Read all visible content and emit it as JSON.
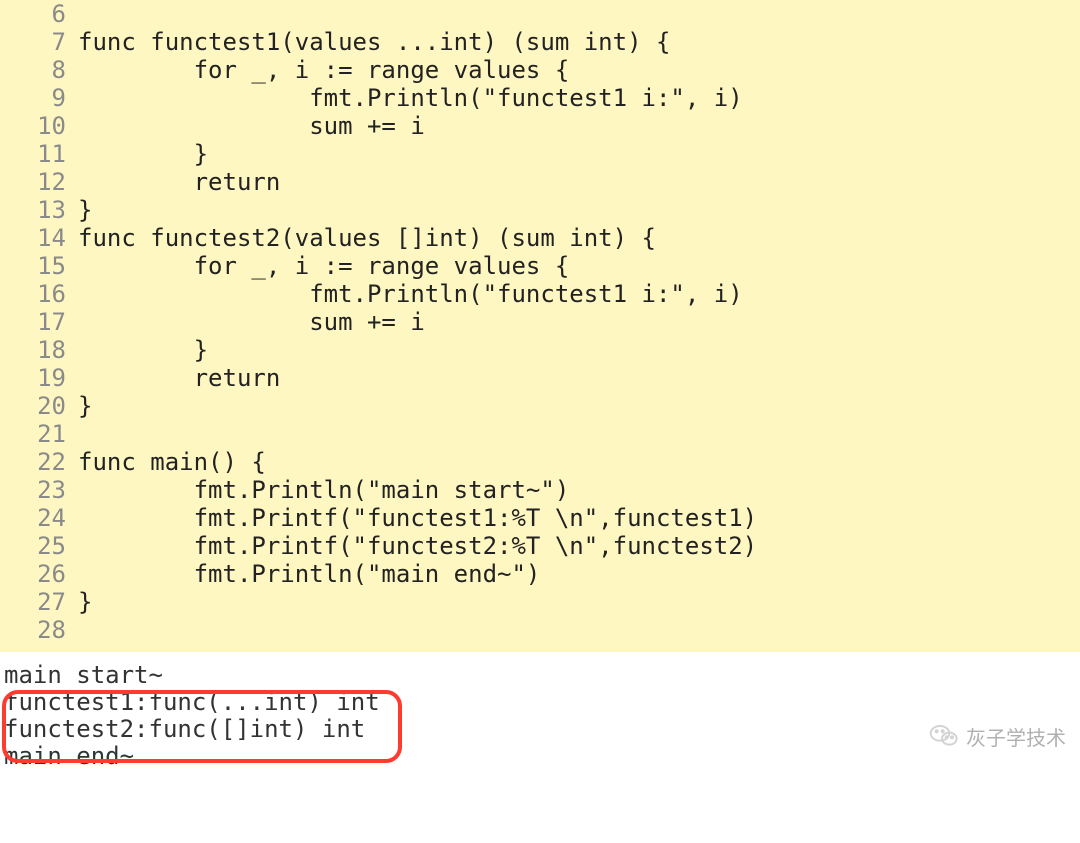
{
  "code": {
    "lines": [
      {
        "n": 6,
        "t": ""
      },
      {
        "n": 7,
        "t": "func functest1(values ...int) (sum int) {"
      },
      {
        "n": 8,
        "t": "        for _, i := range values {"
      },
      {
        "n": 9,
        "t": "                fmt.Println(\"functest1 i:\", i)"
      },
      {
        "n": 10,
        "t": "                sum += i"
      },
      {
        "n": 11,
        "t": "        }"
      },
      {
        "n": 12,
        "t": "        return"
      },
      {
        "n": 13,
        "t": "}"
      },
      {
        "n": 14,
        "t": "func functest2(values []int) (sum int) {"
      },
      {
        "n": 15,
        "t": "        for _, i := range values {"
      },
      {
        "n": 16,
        "t": "                fmt.Println(\"functest1 i:\", i)"
      },
      {
        "n": 17,
        "t": "                sum += i"
      },
      {
        "n": 18,
        "t": "        }"
      },
      {
        "n": 19,
        "t": "        return"
      },
      {
        "n": 20,
        "t": "}"
      },
      {
        "n": 21,
        "t": ""
      },
      {
        "n": 22,
        "t": "func main() {"
      },
      {
        "n": 23,
        "t": "        fmt.Println(\"main start~\")"
      },
      {
        "n": 24,
        "t": "        fmt.Printf(\"functest1:%T \\n\",functest1)"
      },
      {
        "n": 25,
        "t": "        fmt.Printf(\"functest2:%T \\n\",functest2)"
      },
      {
        "n": 26,
        "t": "        fmt.Println(\"main end~\")"
      },
      {
        "n": 27,
        "t": "}"
      },
      {
        "n": 28,
        "t": ""
      }
    ]
  },
  "output": {
    "lines": [
      "main start~",
      "functest1:func(...int) int",
      "functest2:func([]int) int",
      "main end~"
    ]
  },
  "watermark": {
    "text": "灰子学技术"
  },
  "colors": {
    "editor_bg": "#fff7c2",
    "gutter": "#8a8a8a",
    "highlight_border": "#ff3b30"
  }
}
